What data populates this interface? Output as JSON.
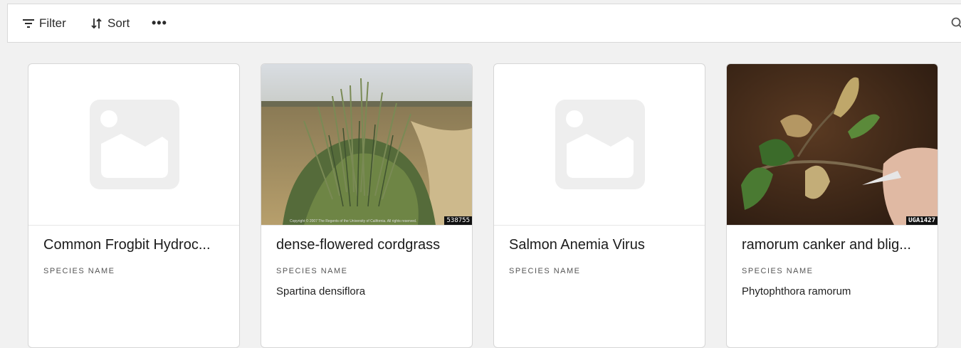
{
  "toolbar": {
    "filter_label": "Filter",
    "sort_label": "Sort",
    "more_label": "•••",
    "icons": [
      "filter-icon",
      "sort-icon",
      "more-icon",
      "search-icon"
    ]
  },
  "cards": [
    {
      "title": "Common Frogbit Hydroc...",
      "field_label": "SPECIES NAME",
      "field_value": "",
      "image": "placeholder-image-icon"
    },
    {
      "title": "dense-flowered cordgrass",
      "field_label": "SPECIES NAME",
      "field_value": "Spartina densiflora",
      "image": "grass-photo",
      "photo_caption": "Copyright © 2007 The Regents of the University of California. All rights reserved.",
      "photo_id": "538755"
    },
    {
      "title": "Salmon Anemia Virus",
      "field_label": "SPECIES NAME",
      "field_value": "",
      "image": "placeholder-image-icon"
    },
    {
      "title": "ramorum canker and blig...",
      "field_label": "SPECIES NAME",
      "field_value": "Phytophthora ramorum",
      "image": "leaf-photo",
      "photo_id": "UGA1427"
    }
  ],
  "colors": {
    "page_background": "#f1f1f1",
    "card_background": "#ffffff",
    "placeholder": "#eeeeee"
  }
}
